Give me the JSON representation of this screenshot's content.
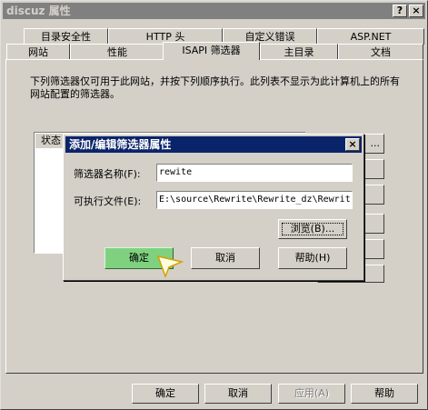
{
  "window": {
    "title": "discuz 属性",
    "help_btn": "?",
    "close_btn": "×"
  },
  "tabs_row1": [
    "目录安全性",
    "HTTP 头",
    "自定义错误",
    "ASP.NET"
  ],
  "tabs_row2": [
    "网站",
    "性能",
    "ISAPI 筛选器",
    "主目录",
    "文档"
  ],
  "panel": {
    "description": "下列筛选器仅可用于此网站，并按下列顺序执行。此列表不显示为此计算机上的所有网站配置的筛选器。",
    "list_header": "状态",
    "side_button_label": "..."
  },
  "dialog": {
    "title": "添加/编辑筛选器属性",
    "close_btn": "×",
    "name_label": "筛选器名称(F):",
    "name_value": "rewite",
    "exe_label": "可执行文件(E):",
    "exe_value": "E:\\source\\Rewrite\\Rewrite_dz\\Rewrit",
    "browse": "浏览(B)...",
    "ok": "确定",
    "cancel": "取消",
    "help": "帮助(H)"
  },
  "footer": {
    "ok": "确定",
    "cancel": "取消",
    "apply": "应用(A)",
    "help": "帮助"
  },
  "colors": {
    "title_inactive": "#808080",
    "title_active": "#0a246a",
    "face": "#d4d0c8",
    "ok_highlight": "#7fd17f"
  }
}
